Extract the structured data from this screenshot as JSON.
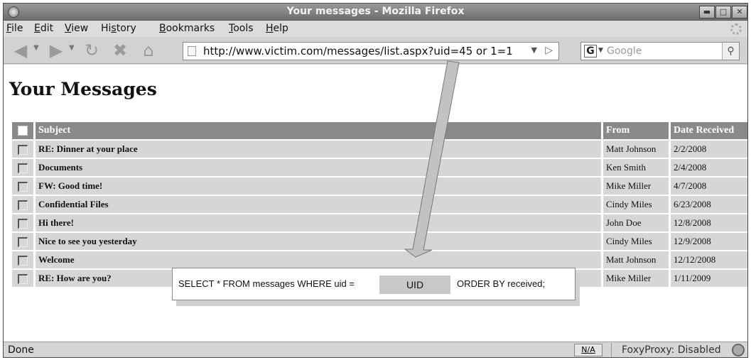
{
  "window": {
    "title": "Your messages - Mozilla Firefox"
  },
  "menubar": {
    "items": [
      {
        "label": "File",
        "key": "F",
        "rest": "ile"
      },
      {
        "label": "Edit",
        "key": "E",
        "rest": "dit"
      },
      {
        "label": "View",
        "key": "V",
        "rest": "iew"
      },
      {
        "label": "History",
        "key": "s",
        "pre": "Hi",
        "rest": "tory"
      },
      {
        "label": "Bookmarks",
        "key": "B",
        "rest": "ookmarks"
      },
      {
        "label": "Tools",
        "key": "T",
        "rest": "ools"
      },
      {
        "label": "Help",
        "key": "H",
        "rest": "elp"
      }
    ]
  },
  "toolbar": {
    "url": "http://www.victim.com/messages/list.aspx?uid=45 or 1=1",
    "search_placeholder": "Google",
    "search_engine_letter": "G"
  },
  "page": {
    "heading": "Your Messages",
    "columns": {
      "subject": "Subject",
      "from": "From",
      "date": "Date Received"
    },
    "messages": [
      {
        "subject": "RE: Dinner at your place",
        "from": "Matt Johnson",
        "date": "2/2/2008"
      },
      {
        "subject": "Documents",
        "from": "Ken Smith",
        "date": "2/4/2008"
      },
      {
        "subject": "FW: Good time!",
        "from": "Mike Miller",
        "date": "4/7/2008"
      },
      {
        "subject": "Confidential Files",
        "from": "Cindy Miles",
        "date": "6/23/2008"
      },
      {
        "subject": "Hi there!",
        "from": "John Doe",
        "date": "12/8/2008"
      },
      {
        "subject": "Nice to see you yesterday",
        "from": "Cindy Miles",
        "date": "12/9/2008"
      },
      {
        "subject": "Welcome",
        "from": "Matt Johnson",
        "date": "12/12/2008"
      },
      {
        "subject": "RE: How are you?",
        "from": "Mike Miller",
        "date": "1/11/2009"
      }
    ]
  },
  "callout": {
    "sql_before": "SELECT * FROM messages WHERE uid =",
    "uid_label": "UID",
    "sql_after": "ORDER BY received;"
  },
  "statusbar": {
    "text": "Done",
    "na_label": "N/A",
    "proxy_label": "FoxyProxy: Disabled"
  }
}
